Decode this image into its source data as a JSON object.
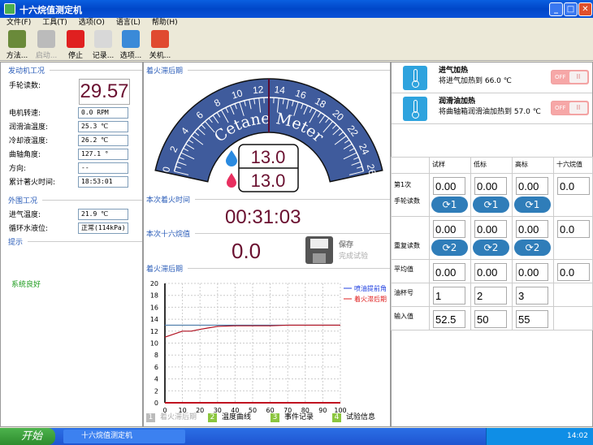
{
  "window": {
    "title": "十六烷值测定机"
  },
  "menu": [
    "文件(F)",
    "工具(T)",
    "选项(O)",
    "语言(L)",
    "帮助(H)"
  ],
  "toolbar": [
    {
      "label": "方法...",
      "icon": "method-icon",
      "color": "#6a8a3a"
    },
    {
      "label": "启动...",
      "icon": "play-icon",
      "color": "#bbbbbb",
      "disabled": true
    },
    {
      "label": "停止",
      "icon": "stop-icon",
      "color": "#e02020"
    },
    {
      "label": "记录...",
      "icon": "record-icon",
      "color": "#d8d8d8"
    },
    {
      "label": "选项...",
      "icon": "gear-icon",
      "color": "#3a8ad8"
    },
    {
      "label": "关机...",
      "icon": "power-icon",
      "color": "#e04a30"
    }
  ],
  "engine": {
    "title": "发动机工况",
    "handwheel_label": "手轮读数:",
    "handwheel": "29.57",
    "rows": [
      {
        "label": "电机转速:",
        "value": "0.0 RPM"
      },
      {
        "label": "润滑油温度:",
        "value": "25.3 ℃"
      },
      {
        "label": "冷却液温度:",
        "value": "26.2 ℃"
      },
      {
        "label": "曲轴角度:",
        "value": "127.1 °"
      },
      {
        "label": "方向:",
        "value": "--"
      },
      {
        "label": "累计著火时间:",
        "value": "18:53:01"
      }
    ]
  },
  "ambient": {
    "title": "外围工况",
    "rows": [
      {
        "label": "进气温度:",
        "value": "21.9 ℃"
      },
      {
        "label": "循环水液位:",
        "value": "正常(114kPa)"
      }
    ]
  },
  "hint": {
    "title": "提示",
    "message": "系统良好"
  },
  "gauge": {
    "title": "着火滞后期",
    "brand": "Cetane Meter",
    "min": 0,
    "max": 26,
    "label_step": 2,
    "pointer": 13,
    "injection_value": "13.0",
    "ignition_value": "13.0"
  },
  "ignition_time": {
    "title": "本次着火时间",
    "value": "00:31:03"
  },
  "cetane": {
    "title": "本次十六烷值",
    "value": "0.0",
    "save_title": "保存",
    "save_sub": "完成试验"
  },
  "chart_title": "着火滞后期",
  "chart_data": {
    "type": "line",
    "x": [
      0,
      10,
      15,
      20,
      30,
      40,
      50,
      60,
      70,
      80,
      90,
      100
    ],
    "ylim": [
      0,
      20
    ],
    "xlim": [
      0,
      100
    ],
    "xticks": [
      0,
      10,
      20,
      30,
      40,
      50,
      60,
      70,
      80,
      90,
      100
    ],
    "yticks": [
      0,
      2,
      4,
      6,
      8,
      10,
      12,
      14,
      16,
      18,
      20
    ],
    "grid": true,
    "legend": "top-right",
    "series": [
      {
        "name": "喷油提前角",
        "color": "#2040e0",
        "line_color": "#4a7aa8",
        "values": [
          13,
          13,
          13,
          13,
          13,
          13,
          13,
          13,
          13,
          13,
          13,
          13
        ]
      },
      {
        "name": "着火滞后期",
        "color": "#e02020",
        "line_color": "#b01020",
        "values": [
          11,
          12,
          12,
          12.3,
          12.8,
          12.9,
          12.9,
          12.9,
          13,
          13,
          13,
          13
        ]
      }
    ]
  },
  "chart_tabs": [
    {
      "n": "1",
      "label": "着火滞后期",
      "active": true
    },
    {
      "n": "2",
      "label": "温度曲线"
    },
    {
      "n": "3",
      "label": "事件记录"
    },
    {
      "n": "4",
      "label": "试验信息"
    }
  ],
  "heaters": [
    {
      "title": "进气加热",
      "desc": "将进气加热到 66.0 ℃",
      "state": "OFF"
    },
    {
      "title": "润滑油加热",
      "desc": "将曲轴箱润滑油加热到 57.0 ℃",
      "state": "OFF"
    }
  ],
  "table": {
    "headers": [
      "试样",
      "低标",
      "高标",
      "十六烷值"
    ],
    "first_label": [
      "第1次",
      "手轮读数"
    ],
    "first": [
      "0.00",
      "0.00",
      "0.00",
      "0.0"
    ],
    "repeat_label": "重复读数",
    "repeat": [
      "0.00",
      "0.00",
      "0.00",
      "0.0"
    ],
    "avg_label": "平均值",
    "avg": [
      "0.00",
      "0.00",
      "0.00",
      "0.0"
    ],
    "cup_label": "油杯号",
    "cup": [
      "1",
      "2",
      "3"
    ],
    "input_label": "输入值",
    "input": [
      "52.5",
      "50",
      "55"
    ]
  },
  "taskbar": {
    "start": "开始",
    "task": "十六烷值测定机",
    "clock": "14:02"
  }
}
